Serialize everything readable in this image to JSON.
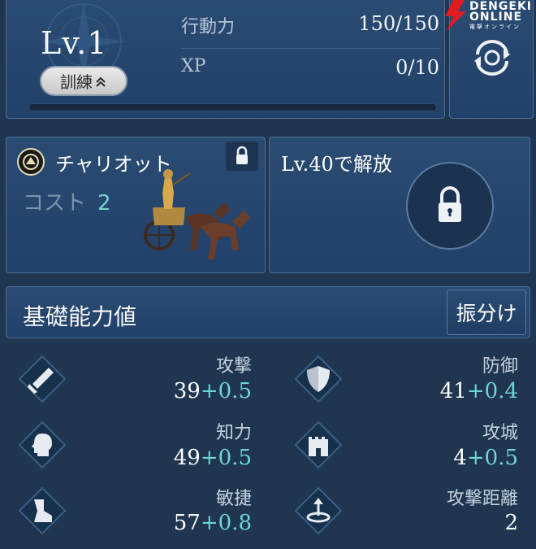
{
  "level": {
    "label": "Lv.1",
    "train_button": "訓練",
    "train_chevron": "≈"
  },
  "stats_top": [
    {
      "key": "行動力",
      "value": "150/150"
    },
    {
      "key": "XP",
      "value": "0/10"
    }
  ],
  "xp_progress": 0,
  "logo": {
    "line1": "DENGEKI",
    "line2": "ONLINE",
    "line3": "電撃オンライン"
  },
  "unit_card": {
    "name": "チャリオット",
    "cost_label": "コスト",
    "cost_value": "2"
  },
  "locked_card": {
    "label": "Lv.40で解放"
  },
  "base_stats": {
    "title": "基礎能力値",
    "allocate_button": "振分け",
    "items": [
      {
        "name": "攻撃",
        "base": "39",
        "bonus": "+0.5",
        "icon": "sword-icon"
      },
      {
        "name": "防御",
        "base": "41",
        "bonus": "+0.4",
        "icon": "shield-icon"
      },
      {
        "name": "知力",
        "base": "49",
        "bonus": "+0.5",
        "icon": "head-icon"
      },
      {
        "name": "攻城",
        "base": "4",
        "bonus": "+0.5",
        "icon": "castle-icon"
      },
      {
        "name": "敏捷",
        "base": "57",
        "bonus": "+0.8",
        "icon": "boot-icon"
      },
      {
        "name": "攻撃距離",
        "base": "2",
        "bonus": "",
        "icon": "range-icon"
      }
    ]
  },
  "colors": {
    "accent": "#6fd5d4",
    "panel": "#23436a",
    "background": "#1f3550"
  }
}
